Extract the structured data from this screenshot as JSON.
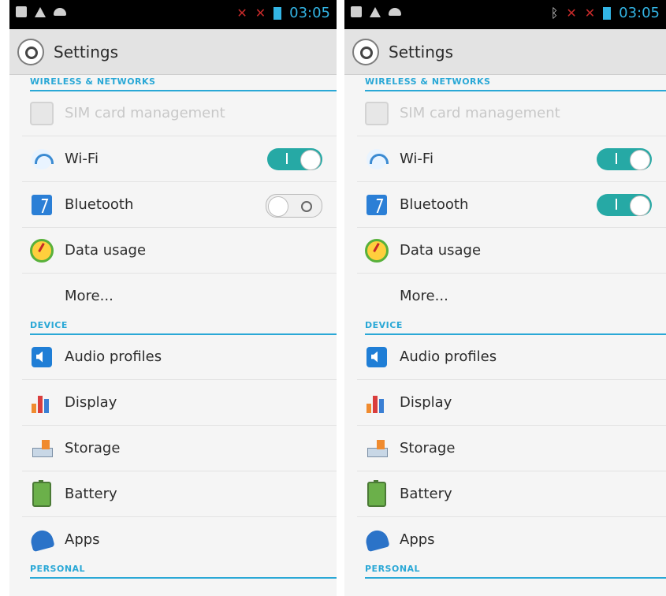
{
  "status_bar": {
    "time": "03:05"
  },
  "settings": {
    "title": "Settings",
    "sections": {
      "wireless": "WIRELESS & NETWORKS",
      "device": "DEVICE",
      "personal": "PERSONAL"
    }
  },
  "left": {
    "items": [
      {
        "label": "SIM card management",
        "disabled": true
      },
      {
        "label": "Wi-Fi",
        "toggle": "on"
      },
      {
        "label": "Bluetooth",
        "toggle": "off"
      },
      {
        "label": "Data usage"
      },
      {
        "label": "More..."
      },
      {
        "label": "Audio profiles"
      },
      {
        "label": "Display"
      },
      {
        "label": "Storage"
      },
      {
        "label": "Battery"
      },
      {
        "label": "Apps"
      }
    ]
  },
  "right": {
    "items": [
      {
        "label": "SIM card management",
        "disabled": true
      },
      {
        "label": "Wi-Fi",
        "toggle": "on"
      },
      {
        "label": "Bluetooth",
        "toggle": "on"
      },
      {
        "label": "Data usage"
      },
      {
        "label": "More..."
      },
      {
        "label": "Audio profiles"
      },
      {
        "label": "Display"
      },
      {
        "label": "Storage"
      },
      {
        "label": "Battery"
      },
      {
        "label": "Apps"
      }
    ]
  }
}
